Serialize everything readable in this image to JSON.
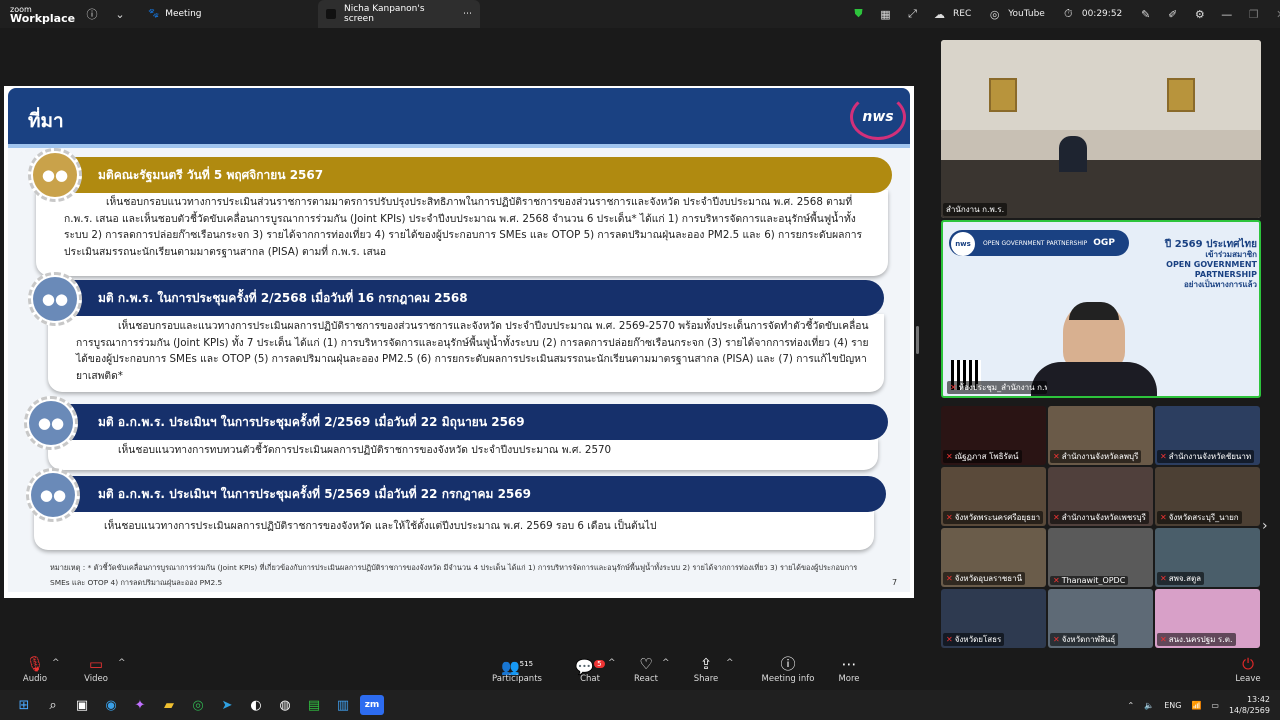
{
  "topbar": {
    "brand_line1": "zoom",
    "brand_line2": "Workplace",
    "meeting_label": "Meeting",
    "screen_tab_label": "Nicha Kanpanon's screen",
    "rec_label": "REC",
    "youtube_label": "YouTube",
    "timer": "00:29:52"
  },
  "slide": {
    "title": "ที่มา",
    "logo_text": "nws",
    "sections": [
      {
        "heading": "มติคณะรัฐมนตรี วันที่ 5 พฤศจิกายน 2567",
        "color": "#b08a10",
        "body": "เห็นชอบกรอบแนวทางการประเมินส่วนราชการตามมาตรการปรับปรุงประสิทธิภาพในการปฏิบัติราชการของส่วนราชการและจังหวัด ประจำปีงบประมาณ พ.ศ. 2568 ตามที่ ก.พ.ร. เสนอ และเห็นชอบตัวชี้วัดขับเคลื่อนการบูรณาการร่วมกัน (Joint KPIs) ประจำปีงบประมาณ พ.ศ. 2568 จำนวน 6 ประเด็น* ได้แก่ 1) การบริหารจัดการและอนุรักษ์พื้นฟูน้ำทั้งระบบ 2) การลดการปล่อยก๊าซเรือนกระจก 3) รายได้จากการท่องเที่ยว 4) รายได้ของผู้ประกอบการ SMEs และ OTOP 5) การลดปริมาณฝุ่นละออง PM2.5 และ 6) การยกระดับผลการประเมินสมรรถนะนักเรียนตามมาตรฐานสากล (PISA) ตามที่ ก.พ.ร. เสนอ"
      },
      {
        "heading": "มติ ก.พ.ร. ในการประชุมครั้งที่ 2/2568 เมื่อวันที่ 16 กรกฎาคม 2568",
        "color": "#16306b",
        "body": "เห็นชอบกรอบและแนวทางการประเมินผลการปฏิบัติราชการของส่วนราชการและจังหวัด ประจำปีงบประมาณ พ.ศ. 2569-2570 พร้อมทั้งประเด็นการจัดทำตัวชี้วัดขับเคลื่อนการบูรณาการร่วมกัน (Joint KPIs) ทั้ง 7 ประเด็น ได้แก่ (1) การบริหารจัดการและอนุรักษ์พื้นฟูน้ำทั้งระบบ (2) การลดการปล่อยก๊าซเรือนกระจก (3) รายได้จากการท่องเที่ยว (4) รายได้ของผู้ประกอบการ SMEs และ OTOP (5) การลดปริมาณฝุ่นละออง PM2.5 (6) การยกระดับผลการประเมินสมรรถนะนักเรียนตามมาตรฐานสากล (PISA) และ (7) การแก้ไขปัญหายาเสพติด*"
      },
      {
        "heading": "มติ อ.ก.พ.ร. ประเมินฯ ในการประชุมครั้งที่ 2/2569 เมื่อวันที่ 22 มิถุนายน 2569",
        "color": "#16306b",
        "body": "เห็นชอบแนวทางการทบทวนตัวชี้วัดการประเมินผลการปฏิบัติราชการของจังหวัด ประจำปีงบประมาณ พ.ศ. 2570"
      },
      {
        "heading": "มติ อ.ก.พ.ร. ประเมินฯ ในการประชุมครั้งที่ 5/2569 เมื่อวันที่ 22 กรกฎาคม 2569",
        "color": "#16306b",
        "body": "เห็นชอบแนวทางการประเมินผลการปฏิบัติราชการของจังหวัด และให้ใช้ตั้งแต่ปีงบประมาณ พ.ศ. 2569 รอบ 6 เดือน เป็นต้นไป"
      }
    ],
    "footnote": "หมายเหตุ : * ตัวชี้วัดขับเคลื่อนการบูรณาการร่วมกัน (Joint KPIs) ที่เกี่ยวข้องกับการประเมินผลการปฏิบัติราชการของจังหวัด มีจำนวน 4 ประเด็น ได้แก่ 1) การบริหารจัดการและอนุรักษ์พื้นฟูน้ำทั้งระบบ 2) รายได้จากการท่องเที่ยว 3) รายได้ของผู้ประกอบการ SMEs และ OTOP 4) การลดปริมาณฝุ่นละออง PM2.5",
    "page_number": "7"
  },
  "video_large": [
    {
      "name": "สำนักงาน ก.พ.ร."
    },
    {
      "name": "ห้องประชุม_สำนักงาน ก.พ.ร.",
      "banner_org": "OPEN GOVERNMENT PARTNERSHIP",
      "banner_ogp": "OGP",
      "banner_line1": "ปี 2569 ประเทศไทย",
      "banner_line2": "เข้าร่วมสมาชิก",
      "banner_line3": "OPEN GOVERNMENT",
      "banner_line4": "PARTNERSHIP",
      "banner_line5": "อย่างเป็นทางการแล้ว"
    }
  ],
  "video_grid": [
    {
      "name": "ณัฐฏภาส โพธิรัตน์",
      "bg": "#2a1414"
    },
    {
      "name": "สำนักงานจังหวัดลพบุรี",
      "bg": "#6a5a48"
    },
    {
      "name": "สำนักงานจังหวัดชัยนาท",
      "bg": "#2c3e60"
    },
    {
      "name": "จังหวัดพระนครศรีอยุธยา",
      "bg": "#5a4a3a"
    },
    {
      "name": "สำนักงานจังหวัดเพชรบุรี",
      "bg": "#50403c"
    },
    {
      "name": "จังหวัดสระบุรี_นายก",
      "bg": "#4c4034"
    },
    {
      "name": "จังหวัดอุบลราชธานี",
      "bg": "#6a5c4a"
    },
    {
      "name": "Thanawit_OPDC",
      "bg": "#5a5a5a"
    },
    {
      "name": "สพจ.สตูล",
      "bg": "#4a5e6a"
    },
    {
      "name": "จังหวัดยโสธร",
      "bg": "#2e3a50"
    },
    {
      "name": "จังหวัดกาฬสินธุ์",
      "bg": "#5e6a76"
    },
    {
      "name": "สนง.นครปฐม ร.ต.",
      "bg": "#d8a0c8"
    }
  ],
  "controls": {
    "audio": "Audio",
    "video": "Video",
    "participants": "Participants",
    "participants_count": "515",
    "chat": "Chat",
    "chat_badge": "5",
    "react": "React",
    "share": "Share",
    "meeting_info": "Meeting info",
    "more": "More",
    "leave": "Leave"
  },
  "taskbar": {
    "lang": "ENG",
    "time": "13:42",
    "date": "14/8/2569"
  },
  "colors": {
    "accent_navy": "#1a4182",
    "gold": "#b08a10",
    "leave_red": "#e02828"
  }
}
